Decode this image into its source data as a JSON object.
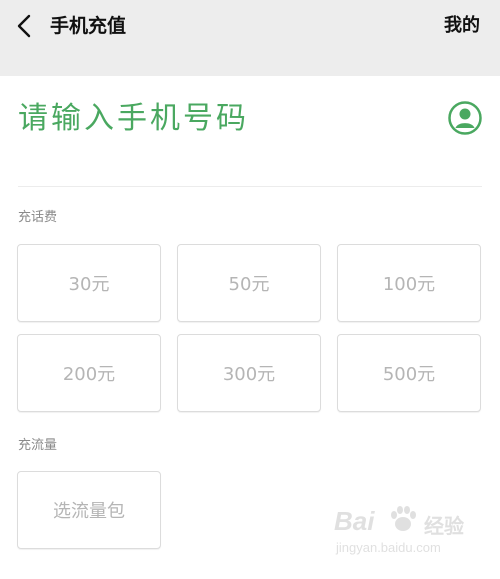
{
  "header": {
    "title": "手机充值",
    "mine_label": "我的",
    "back_icon": "chevron-left-icon"
  },
  "phone": {
    "placeholder": "请输入手机号码",
    "value": "",
    "contact_icon": "person-circle-icon",
    "accent_color": "#4aa860"
  },
  "call_credit": {
    "label": "充话费",
    "options": [
      "30元",
      "50元",
      "100元",
      "200元",
      "300元",
      "500元"
    ]
  },
  "data_plan": {
    "label": "充流量",
    "options": [
      "选流量包"
    ]
  },
  "watermark": {
    "brand": "Bai",
    "brand_suffix": "经验",
    "url": "jingyan.baidu.com"
  }
}
